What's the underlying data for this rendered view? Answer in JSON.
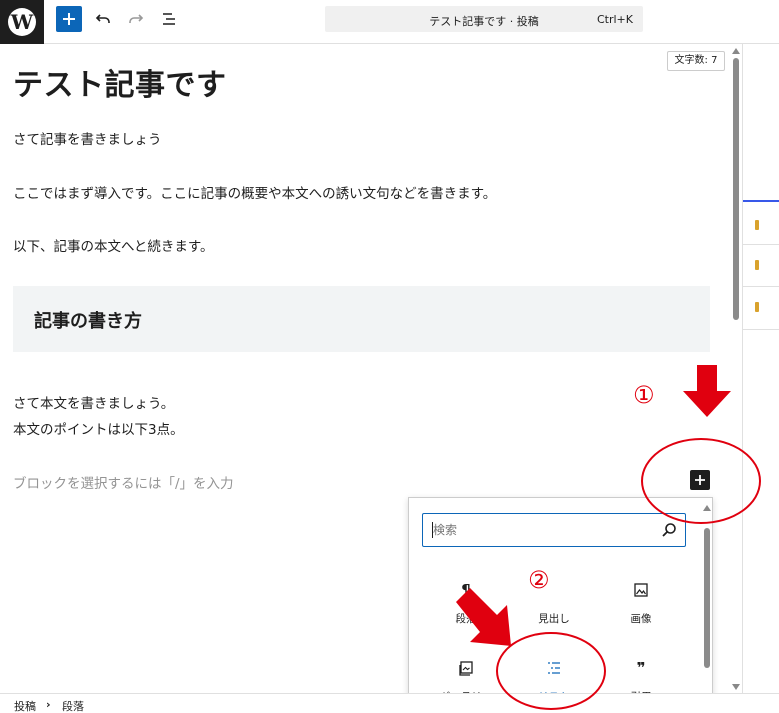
{
  "toolbar": {
    "logo_letter": "W",
    "command_title": "テスト記事です · 投稿",
    "command_shortcut": "Ctrl+K"
  },
  "editor": {
    "word_count": "文字数: 7",
    "title": "テスト記事です",
    "paragraphs": [
      "さて記事を書きましょう",
      "ここではまず導入です。ここに記事の概要や本文への誘い文句などを書きます。",
      "以下、記事の本文へと続きます。"
    ],
    "heading": "記事の書き方",
    "body_lines": [
      "さて本文を書きましょう。",
      "本文のポイントは以下3点。"
    ],
    "placeholder": "ブロックを選択するには「/」を入力"
  },
  "inserter": {
    "search_placeholder": "検索",
    "blocks": [
      {
        "label": "段落",
        "icon": "paragraph-icon",
        "glyph": "¶"
      },
      {
        "label": "見出し",
        "icon": "heading-icon",
        "glyph": "H"
      },
      {
        "label": "画像",
        "icon": "image-icon",
        "glyph": ""
      },
      {
        "label": "ギャラリー",
        "icon": "gallery-icon",
        "glyph": ""
      },
      {
        "label": "リスト",
        "icon": "list-icon",
        "glyph": ""
      },
      {
        "label": "引用",
        "icon": "quote-icon",
        "glyph": "❞"
      }
    ]
  },
  "breadcrumb": {
    "items": [
      "投稿",
      "段落"
    ],
    "separator": "›"
  },
  "annotations": {
    "step1": "①",
    "step2": "②",
    "color": "#e0000f"
  },
  "colors": {
    "accent": "#0c66b8",
    "logo_bg": "#1e1e1e",
    "heading_bg": "#f2f4f5"
  }
}
